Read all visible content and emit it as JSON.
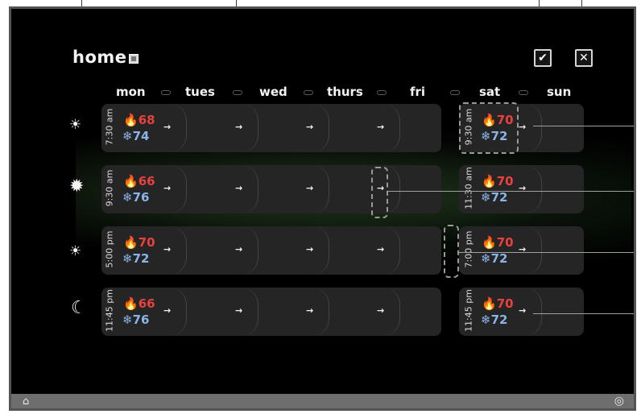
{
  "header": {
    "title": "home",
    "confirm_icon": "✔",
    "cancel_icon": "✕"
  },
  "days": [
    "mon",
    "tues",
    "wed",
    "thurs",
    "fri",
    "sat",
    "sun"
  ],
  "rows": [
    {
      "icon": "sunrise-icon",
      "glyph": "☀",
      "time": "7:30 am",
      "heat": "68",
      "cool": "74",
      "sat_time": "9:30 am",
      "sat_heat": "70",
      "sat_cool": "72"
    },
    {
      "icon": "sun-icon",
      "glyph": "✹",
      "time": "9:30 am",
      "heat": "66",
      "cool": "76",
      "sat_time": "11:30 am",
      "sat_heat": "70",
      "sat_cool": "72"
    },
    {
      "icon": "sunset-icon",
      "glyph": "☀",
      "time": "5:00 pm",
      "heat": "70",
      "cool": "72",
      "sat_time": "7:00 pm",
      "sat_heat": "70",
      "sat_cool": "72"
    },
    {
      "icon": "moon-icon",
      "glyph": "☾",
      "time": "11:45 pm",
      "heat": "66",
      "cool": "76",
      "sat_time": "11:45 pm",
      "sat_heat": "70",
      "sat_cool": "72"
    }
  ],
  "symbols": {
    "heat": "🔥",
    "cool": "❄",
    "arrow": "→"
  },
  "footer": {
    "home_icon": "⌂",
    "settings_icon": "◎"
  },
  "colors": {
    "heat": "#e8413e",
    "cool": "#8ab4e8",
    "background": "#000000"
  }
}
